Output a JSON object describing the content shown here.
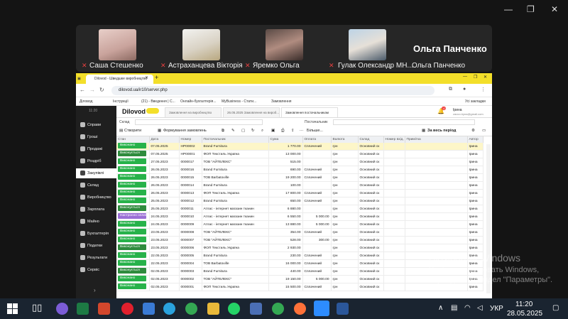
{
  "meeting": {
    "participants": [
      {
        "name": "Саша Стешенко"
      },
      {
        "name": "Астраханцева Вікторія"
      },
      {
        "name": "Яремко Ольга"
      },
      {
        "name": "Гулак Олександр МН..."
      },
      {
        "name": "Ольга Панченко"
      }
    ],
    "active_speaker": "Ольга Панченко"
  },
  "browser": {
    "tabs": [
      {
        "label": "Dilovod - Шведшке виробництво"
      },
      {
        "label": "Замовлення постачальникам"
      }
    ],
    "url": "dilovod.ua/ir10/server.php",
    "bookmarks": [
      "Діловод",
      "Інструкції",
      "(21) - Введення | С...",
      "Онлайн-бухгалтерія...",
      "MyBusiness - Стати...",
      "Замовлення",
      "Усі закладки"
    ]
  },
  "app": {
    "logo": "Dilovod",
    "sidebar_header": "11:20",
    "sidebar_items": [
      {
        "label": "Справи"
      },
      {
        "label": "Гроші"
      },
      {
        "label": "Продажі"
      },
      {
        "label": "Роздріб"
      },
      {
        "label": "Закупівлі"
      },
      {
        "label": "Склад"
      },
      {
        "label": "Виробництво"
      },
      {
        "label": "Зарплата"
      },
      {
        "label": "Майно"
      },
      {
        "label": "Бухгалтерія"
      },
      {
        "label": "Податки"
      },
      {
        "label": "Результати"
      },
      {
        "label": "Сервіс"
      }
    ],
    "sidebar_collapse": "›",
    "doc_tabs": [
      "Замовлення на виробництво",
      "26.05.2025 Замовлення на вироб...",
      "Замовлення постачальникам"
    ],
    "user": {
      "name": "Ірина",
      "email": "zaoco.iryna@gmail.com",
      "notifications": "12"
    },
    "filters": {
      "warehouse_label": "Склад",
      "supplier_label": "Постачальник"
    },
    "toolbar": {
      "create": "Створити",
      "form_orders": "Формування замовлень",
      "more": "Більше...",
      "period": "За весь період"
    },
    "columns": [
      "Стан",
      "Дата",
      "Номер",
      "Постачальник",
      "Сума",
      "Оплата",
      "Валюта",
      "Склад",
      "Номер вхід.",
      "Примітка",
      "Автор"
    ],
    "rows": [
      {
        "status": "Виконано",
        "date": "07.05.2025",
        "number": "НР00002",
        "supplier": "Brand Furnitura",
        "sum": "1 770.00",
        "payment": "Сплачений",
        "currency": "грн",
        "warehouse": "Основний ск",
        "author": "Ірина",
        "selected": true
      },
      {
        "status": "Виконується",
        "date": "07.05.2025",
        "number": "НР00001",
        "supplier": "ФОП Текстиль Україна",
        "sum": "13 000.00",
        "payment": "",
        "currency": "грн",
        "warehouse": "Основний ск",
        "author": "Ірина"
      },
      {
        "status": "Виконано",
        "date": "27.05.2023",
        "number": "0000017",
        "supplier": "ТОВ \"АЙТЕЛЕКС\"",
        "sum": "515.00",
        "payment": "",
        "currency": "грн",
        "warehouse": "Основний ск",
        "author": "Ірина"
      },
      {
        "status": "Виконано",
        "date": "26.05.2023",
        "number": "0000016",
        "supplier": "Brand Furnitura",
        "sum": "690.00",
        "payment": "Сплачений",
        "currency": "грн",
        "warehouse": "Основний ск",
        "author": "Ірина"
      },
      {
        "status": "Виконано",
        "date": "26.05.2023",
        "number": "0000015",
        "supplier": "ТОВ Barbatoville",
        "sum": "19 200.00",
        "payment": "Сплачений",
        "currency": "грн",
        "warehouse": "Основний ск",
        "author": "Ірина"
      },
      {
        "status": "Виконано",
        "date": "26.05.2023",
        "number": "0000014",
        "supplier": "Brand Furnitura",
        "sum": "100.00",
        "payment": "",
        "currency": "грн",
        "warehouse": "Основний ск",
        "author": "Ірина"
      },
      {
        "status": "Виконано",
        "date": "26.05.2023",
        "number": "0000013",
        "supplier": "ФОП Текстиль Україна",
        "sum": "17 800.00",
        "payment": "Сплачений",
        "currency": "грн",
        "warehouse": "Основний ск",
        "author": "Ірина"
      },
      {
        "status": "Виконано",
        "date": "25.05.2023",
        "number": "0000012",
        "supplier": "Brand Furnitura",
        "sum": "650.00",
        "payment": "Сплачений",
        "currency": "грн",
        "warehouse": "Основний ск",
        "author": "Ірина"
      },
      {
        "status": "Виконується",
        "date": "25.05.2023",
        "number": "0000011",
        "supplier": "Атлас - інтернет магазин тканин",
        "sum": "6 880.00",
        "payment": "",
        "currency": "грн",
        "warehouse": "Основний ск",
        "author": "Ірина"
      },
      {
        "status": "Настроєно оплату",
        "date": "24.05.2023",
        "number": "0000010",
        "supplier": "Атлас - інтернет магазин тканин",
        "sum": "6 550.00",
        "payment": "5 000.00",
        "currency": "грн",
        "warehouse": "Основний ск",
        "author": "Ірина"
      },
      {
        "status": "Виконано",
        "date": "24.05.2023",
        "number": "0000009",
        "supplier": "Атлас - інтернет магазин тканин",
        "sum": "13 880.00",
        "payment": "5 000.00",
        "currency": "грн",
        "warehouse": "Основний ск",
        "author": "Ірина"
      },
      {
        "status": "Виконано",
        "date": "23.05.2023",
        "number": "0000008",
        "supplier": "ТОВ \"АЙТЕЛЕКС\"",
        "sum": "354.00",
        "payment": "Сплачений",
        "currency": "грн",
        "warehouse": "Основний ск",
        "author": "Ірина"
      },
      {
        "status": "Виконано",
        "date": "23.05.2023",
        "number": "0000007",
        "supplier": "ТОВ \"АЙТЕЛЕКС\"",
        "sum": "528.00",
        "payment": "300.00",
        "currency": "грн",
        "warehouse": "Основний ск",
        "author": "Ірина"
      },
      {
        "status": "Виконується",
        "date": "23.05.2023",
        "number": "0000006",
        "supplier": "ФОП Текстиль Україна",
        "sum": "2 930.00",
        "payment": "",
        "currency": "грн",
        "warehouse": "Основний ск",
        "author": "Ірина"
      },
      {
        "status": "Виконано",
        "date": "22.05.2023",
        "number": "0000005",
        "supplier": "Brand Furnitura",
        "sum": "230.00",
        "payment": "Сплачений",
        "currency": "грн",
        "warehouse": "Основний ск",
        "author": "Ірина"
      },
      {
        "status": "Виконано",
        "date": "22.05.2023",
        "number": "0000004",
        "supplier": "ТОВ Barbatoville",
        "sum": "16 000.00",
        "payment": "Сплачений",
        "currency": "грн",
        "warehouse": "Основний ск",
        "author": "Ірина"
      },
      {
        "status": "Виконується",
        "date": "02.05.2023",
        "number": "0000003",
        "supplier": "Brand Furnitura",
        "sum": "440.00",
        "payment": "Сплачений",
        "currency": "грн",
        "warehouse": "Основний ск",
        "author": "Ірина"
      },
      {
        "status": "Виконано",
        "date": "02.05.2023",
        "number": "0000002",
        "supplier": "ТОВ \"АЙТЕЛЕКС\"",
        "sum": "19 150.00",
        "payment": "5 000.00",
        "currency": "грн",
        "warehouse": "Основний ск",
        "author": "Ірина"
      },
      {
        "status": "Виконано",
        "date": "02.05.2023",
        "number": "0000001",
        "supplier": "ФОП Текстиль Україна",
        "sum": "15 500.00",
        "payment": "Сплачений",
        "currency": "грн",
        "warehouse": "Основний ск",
        "author": "Ірина"
      }
    ]
  },
  "watermark": {
    "line1": "Активация Windows",
    "line2": "Чтобы активировать Windows,",
    "line3": "перейдите в раздел \"Параметры\"."
  },
  "taskbar": {
    "language": "УКР",
    "time": "11:20",
    "date": "28.05.2025"
  },
  "colors": {
    "status_done": "#27b24a",
    "status_running": "#2e8b3d",
    "status_payment": "#9b6fd6",
    "accent_yellow": "#f3df2a"
  }
}
